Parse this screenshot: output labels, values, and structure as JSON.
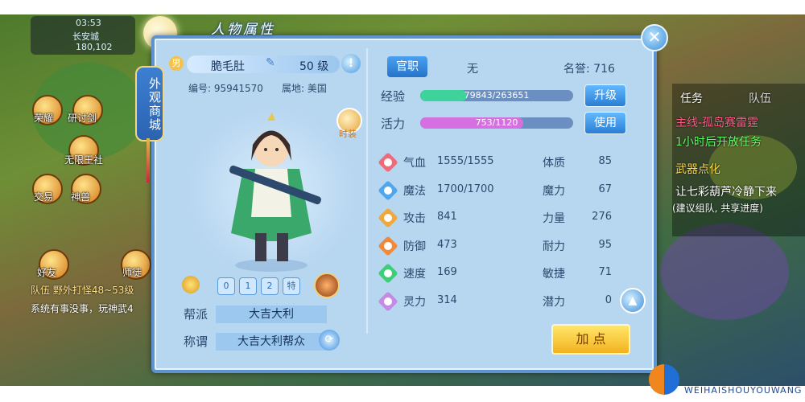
{
  "window": {
    "title": "人物属性"
  },
  "shop_tag": "外观商城",
  "hud": {
    "time": "03:53",
    "location": "长安城",
    "coords": "180,102"
  },
  "world_left_labels": [
    "荣耀",
    "研讨剑",
    "无限王社",
    "交易",
    "神兽",
    "好友",
    "师徒"
  ],
  "chat": [
    "队伍 野外打怪48~53级",
    "系统有事没事，玩神武4"
  ],
  "tasks": {
    "tab_task": "任务",
    "tab_team": "队伍",
    "line1": "主线-孤岛赛雷霆",
    "line2": "1小时后开放任务",
    "line3": "武器点化",
    "line4": "让七彩葫芦冷静下来",
    "line5": "(建议组队, 共享进度)"
  },
  "character": {
    "gender_icon": "男",
    "name": "脆毛肚",
    "level_text": "50 级",
    "id_label": "编号: 95941570",
    "region_label": "属地: 美国",
    "fashion_label": "时装",
    "chips": [
      "0",
      "1",
      "2",
      "特"
    ]
  },
  "guild": {
    "key": "帮派",
    "value": "大吉大利"
  },
  "honor_title": {
    "key": "称谓",
    "value": "大吉大利帮众"
  },
  "rank": {
    "button": "官职",
    "value": "无",
    "reputation": "名誉: 716"
  },
  "bars": {
    "exp": {
      "label": "经验",
      "text": "79843/263651",
      "fraction": 0.303,
      "button": "升级",
      "color": "#3ed39a"
    },
    "vitality": {
      "label": "活力",
      "text": "753/1120",
      "fraction": 0.672,
      "button": "使用",
      "color": "#d670e0"
    }
  },
  "stats": [
    {
      "name": "气血",
      "value": "1555/1555",
      "color": "#f06a7a"
    },
    {
      "name": "魔法",
      "value": "1700/1700",
      "color": "#4ea6ef"
    },
    {
      "name": "攻击",
      "value": "841",
      "color": "#f2a73a"
    },
    {
      "name": "防御",
      "value": "473",
      "color": "#f08a3a"
    },
    {
      "name": "速度",
      "value": "169",
      "color": "#3fce78"
    },
    {
      "name": "灵力",
      "value": "314",
      "color": "#c58ae6"
    }
  ],
  "attributes": [
    {
      "name": "体质",
      "value": "85"
    },
    {
      "name": "魔力",
      "value": "67"
    },
    {
      "name": "力量",
      "value": "276"
    },
    {
      "name": "耐力",
      "value": "95"
    },
    {
      "name": "敏捷",
      "value": "71"
    },
    {
      "name": "潜力",
      "value": "0"
    }
  ],
  "add_points_button": "加 点",
  "watermark": "WEIHAISHOUYOUWANG"
}
